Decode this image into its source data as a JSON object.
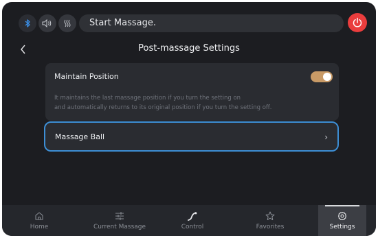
{
  "status_bar": {
    "bluetooth_icon": "bluetooth-icon",
    "sound_icon": "speaker-icon",
    "heat_icon": "heat-icon",
    "title": "Start Massage.",
    "power_icon": "power-icon",
    "power_color": "#ea3d3d"
  },
  "header": {
    "back_icon": "chevron-left-icon",
    "title": "Post-massage Settings"
  },
  "maintain_position": {
    "label": "Maintain Position",
    "toggle_on": true,
    "toggle_color": "#c89a66",
    "description_line1": "It maintains the last massage position if you turn the setting on",
    "description_line2": "and automatically returns to its original position if you turn the setting off."
  },
  "massage_ball": {
    "label": "Massage Ball",
    "chevron": "›",
    "highlight_color": "#3d8fd6"
  },
  "bottom_nav": {
    "items": [
      {
        "label": "Home",
        "icon": "home-icon",
        "active": false
      },
      {
        "label": "Current Massage",
        "icon": "sliders-icon",
        "active": false
      },
      {
        "label": "Control",
        "icon": "control-curve-icon",
        "active": false
      },
      {
        "label": "Favorites",
        "icon": "star-icon",
        "active": false
      },
      {
        "label": "Settings",
        "icon": "gear-icon",
        "active": true
      }
    ]
  }
}
